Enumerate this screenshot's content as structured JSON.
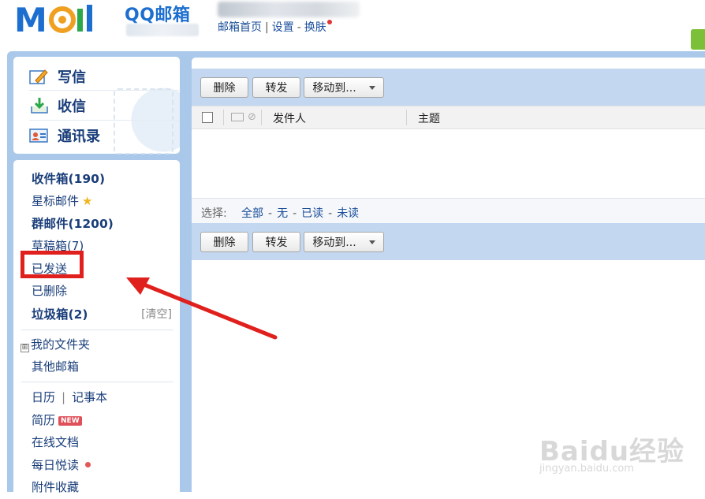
{
  "brand": {
    "logo_text": "MOil",
    "product": "QQ邮箱",
    "colors": {
      "logo_blue": "#1d6fcf",
      "logo_orange": "#f0a020",
      "frame_blue": "#a9c8ea"
    }
  },
  "header": {
    "links": [
      "邮箱首页",
      "设置",
      "换肤"
    ],
    "separators": [
      "|",
      "-"
    ]
  },
  "actions": [
    {
      "label": "写信",
      "icon": "pencil-note-icon"
    },
    {
      "label": "收信",
      "icon": "inbox-download-icon"
    },
    {
      "label": "通讯录",
      "icon": "contact-card-icon"
    }
  ],
  "folders": {
    "inbox": "收件箱(190)",
    "starred": "星标邮件",
    "group": "群邮件(1200)",
    "drafts": "草稿箱(7)",
    "sent": "已发送",
    "deleted": "已删除",
    "trash": "垃圾箱(2)",
    "trash_clear": "[清空]",
    "my_folders": "我的文件夹",
    "my_folders_toggle": "⊞",
    "other_mailbox": "其他邮箱",
    "calendar": "日历",
    "tools_sep": "|",
    "notes": "记事本",
    "resume": "简历",
    "resume_badge": "NEW",
    "docs": "在线文档",
    "daily": "每日悦读",
    "attachments": "附件收藏"
  },
  "toolbar": {
    "delete": "删除",
    "forward": "转发",
    "move_to": "移动到..."
  },
  "table": {
    "columns": [
      "发件人",
      "主题"
    ]
  },
  "select_bar": {
    "label": "选择:",
    "options": [
      "全部",
      "无",
      "已读",
      "未读"
    ]
  },
  "annotation": {
    "box_color": "#e0201c",
    "arrow_color": "#e0201c",
    "target": "已发送"
  },
  "watermark": {
    "main": "Baidu经验",
    "sub": "jingyan.baidu.com"
  }
}
